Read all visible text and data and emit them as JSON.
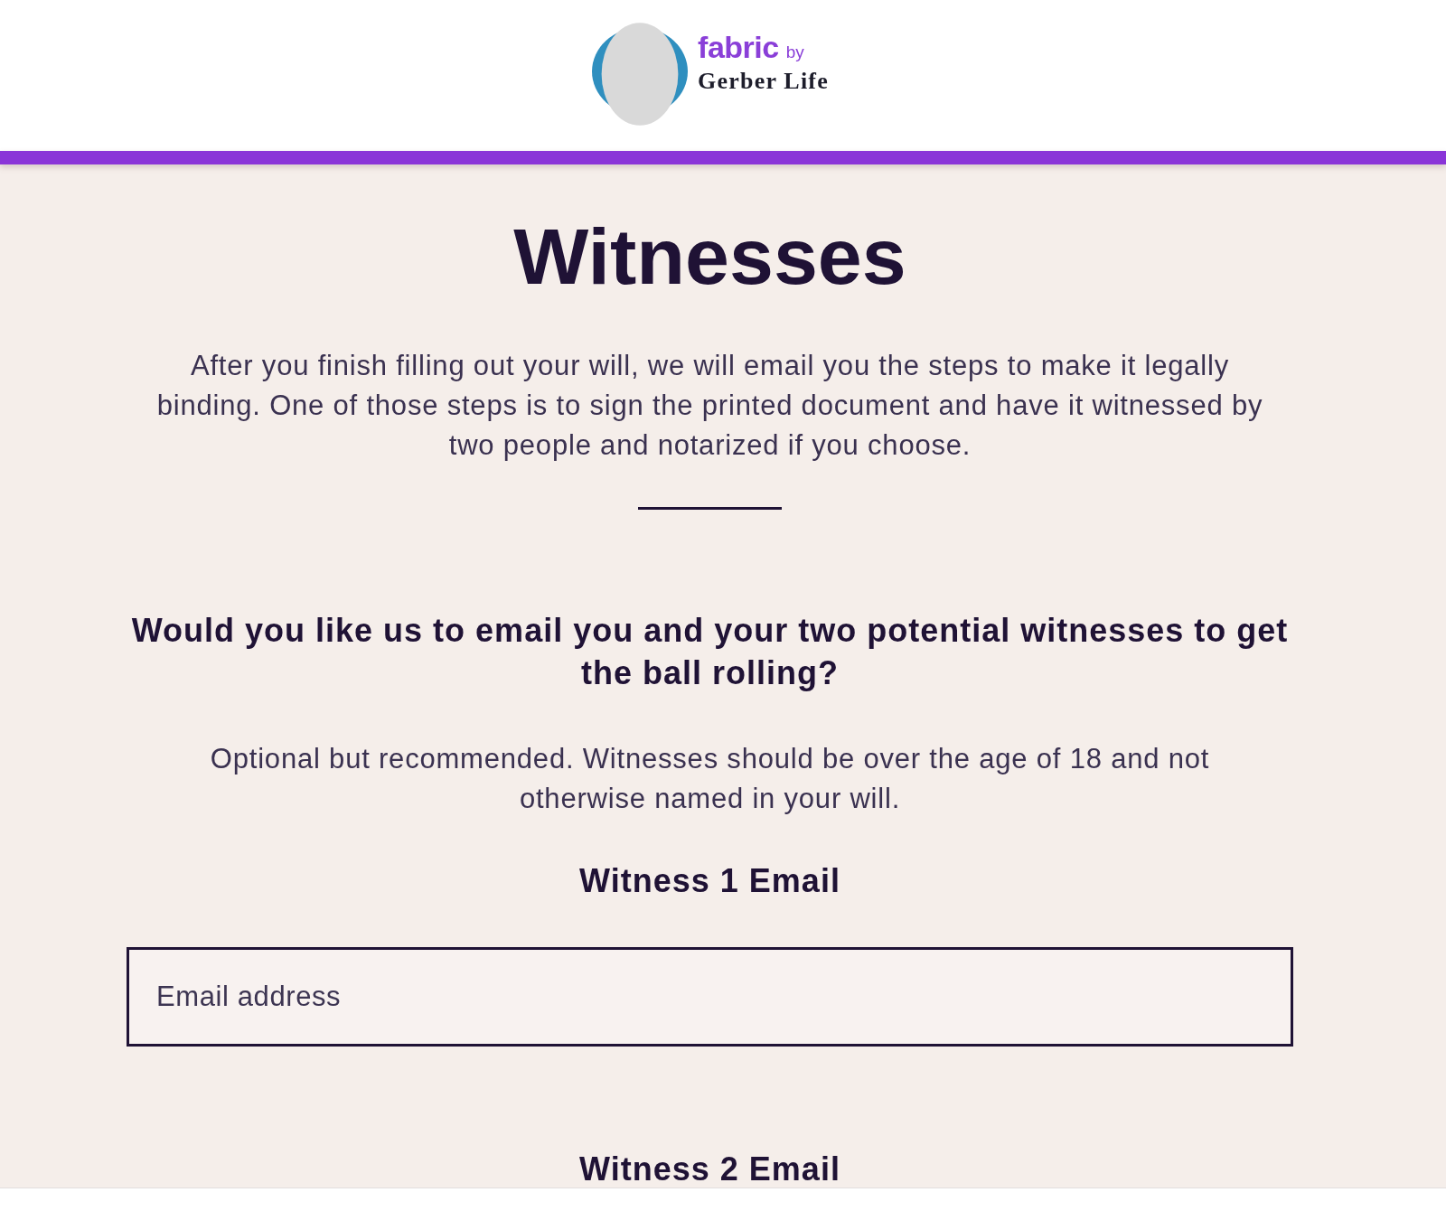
{
  "header": {
    "logo": {
      "brand": "fabric",
      "connector": "by",
      "company": "Gerber Life"
    }
  },
  "page": {
    "title": "Witnesses",
    "intro": "After you finish filling out your will, we will email you the steps to make it legally binding. One of those steps is to sign the printed document and have it witnessed by two people and notarized if you choose.",
    "question": "Would you like us to email you and your two potential witnesses to get the ball rolling?",
    "note": "Optional but recommended. Witnesses should be over the age of 18 and not otherwise named in your will.",
    "fields": [
      {
        "label": "Witness 1 Email",
        "placeholder": "Email address"
      },
      {
        "label": "Witness 2 Email"
      }
    ]
  }
}
